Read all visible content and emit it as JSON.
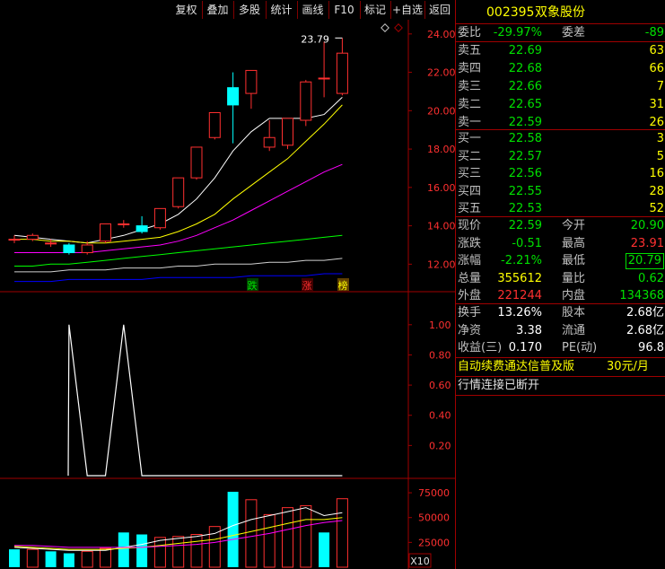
{
  "toolbar": {
    "buttons": [
      "复权",
      "叠加",
      "多股",
      "统计",
      "画线",
      "F10",
      "标记",
      "+自选",
      "返回"
    ]
  },
  "stock": {
    "code": "002395",
    "name": "双象股份"
  },
  "main_chart": {
    "high_label": "23.79",
    "y_ticks": [
      "24.00",
      "22.00",
      "20.00",
      "18.00",
      "16.00",
      "14.00",
      "12.00"
    ],
    "markers": [
      "跌",
      "涨",
      "榜"
    ]
  },
  "indicator_chart": {
    "y_ticks": [
      "1.00",
      "0.80",
      "0.60",
      "0.40",
      "0.20"
    ]
  },
  "volume_chart": {
    "y_ticks": [
      "75000",
      "50000",
      "25000"
    ],
    "unit": "X10"
  },
  "chart_data": [
    {
      "type": "candlestick",
      "ylim": [
        10.8,
        24.6
      ],
      "candles": [
        {
          "o": 13.3,
          "c": 13.3,
          "h": 13.5,
          "l": 13.1
        },
        {
          "o": 13.3,
          "c": 13.5,
          "h": 13.6,
          "l": 13.2
        },
        {
          "o": 13.1,
          "c": 13.1,
          "h": 13.3,
          "l": 12.9
        },
        {
          "o": 13.0,
          "c": 12.6,
          "h": 13.1,
          "l": 12.5
        },
        {
          "o": 12.6,
          "c": 13.0,
          "h": 13.2,
          "l": 12.5
        },
        {
          "o": 13.2,
          "c": 14.1,
          "h": 14.1,
          "l": 13.1
        },
        {
          "o": 14.1,
          "c": 14.1,
          "h": 14.3,
          "l": 13.9
        },
        {
          "o": 14.0,
          "c": 13.7,
          "h": 14.5,
          "l": 13.6
        },
        {
          "o": 13.9,
          "c": 14.9,
          "h": 14.9,
          "l": 13.8
        },
        {
          "o": 15.0,
          "c": 16.5,
          "h": 16.5,
          "l": 14.9
        },
        {
          "o": 16.5,
          "c": 18.1,
          "h": 18.1,
          "l": 16.4
        },
        {
          "o": 18.6,
          "c": 19.9,
          "h": 19.9,
          "l": 18.5
        },
        {
          "o": 21.2,
          "c": 20.3,
          "h": 22.0,
          "l": 18.3
        },
        {
          "o": 20.9,
          "c": 22.1,
          "h": 22.1,
          "l": 20.1
        },
        {
          "o": 18.1,
          "c": 18.6,
          "h": 19.5,
          "l": 17.9
        },
        {
          "o": 18.2,
          "c": 19.6,
          "h": 19.6,
          "l": 18.0
        },
        {
          "o": 19.5,
          "c": 21.5,
          "h": 21.6,
          "l": 19.2
        },
        {
          "o": 21.7,
          "c": 21.7,
          "h": 23.6,
          "l": 20.7
        },
        {
          "o": 20.9,
          "c": 23.0,
          "h": 23.79,
          "l": 20.8
        }
      ],
      "series": [
        {
          "name": "MA5",
          "color": "#ffffff",
          "values": [
            13.5,
            13.4,
            13.3,
            13.2,
            13.1,
            13.3,
            13.5,
            13.8,
            14.1,
            14.6,
            15.4,
            16.5,
            17.9,
            18.9,
            19.6,
            19.6,
            19.6,
            19.8,
            20.7
          ]
        },
        {
          "name": "MA10",
          "color": "#ffff00",
          "values": [
            13.3,
            13.3,
            13.2,
            13.2,
            13.1,
            13.1,
            13.2,
            13.3,
            13.4,
            13.7,
            14.1,
            14.6,
            15.4,
            16.1,
            16.8,
            17.5,
            18.4,
            19.3,
            20.3
          ]
        },
        {
          "name": "MA20",
          "color": "#ff00ff",
          "values": [
            12.6,
            12.6,
            12.6,
            12.6,
            12.6,
            12.7,
            12.8,
            12.9,
            13.0,
            13.2,
            13.5,
            13.9,
            14.3,
            14.8,
            15.3,
            15.8,
            16.3,
            16.8,
            17.2
          ]
        },
        {
          "name": "MA30",
          "color": "#00ff00",
          "values": [
            11.9,
            11.9,
            12.0,
            12.0,
            12.1,
            12.2,
            12.3,
            12.4,
            12.5,
            12.6,
            12.7,
            12.8,
            12.9,
            13.0,
            13.1,
            13.2,
            13.3,
            13.4,
            13.5
          ]
        },
        {
          "name": "MA60",
          "color": "#d0d0d0",
          "values": [
            11.6,
            11.6,
            11.6,
            11.7,
            11.7,
            11.7,
            11.8,
            11.8,
            11.8,
            11.9,
            11.9,
            12.0,
            12.0,
            12.0,
            12.1,
            12.1,
            12.2,
            12.2,
            12.3
          ]
        },
        {
          "name": "MA120",
          "color": "#0000ff",
          "values": [
            11.1,
            11.1,
            11.1,
            11.2,
            11.2,
            11.2,
            11.2,
            11.2,
            11.3,
            11.3,
            11.3,
            11.3,
            11.3,
            11.4,
            11.4,
            11.4,
            11.4,
            11.5,
            11.5
          ]
        }
      ]
    },
    {
      "type": "line",
      "ylim": [
        0,
        1.1
      ],
      "x": [
        0,
        1,
        2,
        3,
        4,
        5,
        6,
        7,
        8,
        9,
        10,
        11,
        12,
        13,
        14,
        15,
        16,
        17,
        18
      ],
      "series": [
        {
          "color": "#ffffff",
          "values": [
            0,
            0,
            0,
            1,
            0,
            0,
            1,
            0,
            0,
            0,
            0,
            0,
            0,
            0,
            0,
            0,
            0,
            0,
            0
          ]
        }
      ]
    },
    {
      "type": "bar",
      "ylim": [
        0,
        85000
      ],
      "values": [
        18000,
        18000,
        16000,
        14000,
        16000,
        19000,
        35000,
        33000,
        30000,
        31000,
        33000,
        41000,
        76000,
        68000,
        53000,
        60000,
        62000,
        35000,
        69000
      ],
      "up": [
        false,
        true,
        false,
        false,
        true,
        true,
        false,
        false,
        true,
        true,
        true,
        true,
        false,
        true,
        true,
        true,
        true,
        false,
        true
      ],
      "series": [
        {
          "color": "#ffffff",
          "values": [
            20000,
            19000,
            18000,
            17000,
            17000,
            17000,
            20000,
            23000,
            27000,
            29000,
            31000,
            34000,
            42000,
            48000,
            52000,
            56000,
            60000,
            52000,
            55000
          ]
        },
        {
          "color": "#ffff00",
          "values": [
            21000,
            20000,
            19000,
            18000,
            18000,
            18000,
            19000,
            20000,
            22000,
            24000,
            26000,
            28000,
            32000,
            36000,
            40000,
            44000,
            48000,
            48000,
            50000
          ]
        },
        {
          "color": "#ff00ff",
          "values": [
            22000,
            22000,
            21000,
            20000,
            20000,
            20000,
            20000,
            20000,
            21000,
            22000,
            23000,
            25000,
            28000,
            31000,
            34000,
            38000,
            42000,
            45000,
            47000
          ]
        }
      ]
    }
  ],
  "quote": {
    "weibi_label": "委比",
    "weibi": "-29.97%",
    "weicha_label": "委差",
    "weicha": "-89",
    "sell": [
      {
        "label": "卖五",
        "price": "22.69",
        "vol": "63"
      },
      {
        "label": "卖四",
        "price": "22.68",
        "vol": "66"
      },
      {
        "label": "卖三",
        "price": "22.66",
        "vol": "7"
      },
      {
        "label": "卖二",
        "price": "22.65",
        "vol": "31"
      },
      {
        "label": "卖一",
        "price": "22.59",
        "vol": "26"
      }
    ],
    "buy": [
      {
        "label": "买一",
        "price": "22.58",
        "vol": "3"
      },
      {
        "label": "买二",
        "price": "22.57",
        "vol": "5"
      },
      {
        "label": "买三",
        "price": "22.56",
        "vol": "16"
      },
      {
        "label": "买四",
        "price": "22.55",
        "vol": "28"
      },
      {
        "label": "买五",
        "price": "22.53",
        "vol": "52"
      }
    ],
    "stats": [
      {
        "l1": "现价",
        "v1": "22.59",
        "c1": "green",
        "l2": "今开",
        "v2": "20.90",
        "c2": "green"
      },
      {
        "l1": "涨跌",
        "v1": "-0.51",
        "c1": "green",
        "l2": "最高",
        "v2": "23.91",
        "c2": "red"
      },
      {
        "l1": "涨幅",
        "v1": "-2.21%",
        "c1": "green",
        "l2": "最低",
        "v2": "20.79",
        "c2": "green"
      },
      {
        "l1": "总量",
        "v1": "355612",
        "c1": "yellow",
        "l2": "量比",
        "v2": "0.62",
        "c2": "green"
      },
      {
        "l1": "外盘",
        "v1": "221244",
        "c1": "red",
        "l2": "内盘",
        "v2": "134368",
        "c2": "green"
      }
    ],
    "fin": [
      {
        "l1": "换手",
        "v1": "13.26%",
        "l2": "股本",
        "v2": "2.68亿"
      },
      {
        "l1": "净资",
        "v1": "3.38",
        "l2": "流通",
        "v2": "2.68亿"
      },
      {
        "l1": "收益(三)",
        "v1": "0.170",
        "l2": "PE(动)",
        "v2": "96.8"
      }
    ]
  },
  "promo": {
    "text": "自动续费通达信普及版",
    "price": "30元/月"
  },
  "status": "行情连接已断开"
}
